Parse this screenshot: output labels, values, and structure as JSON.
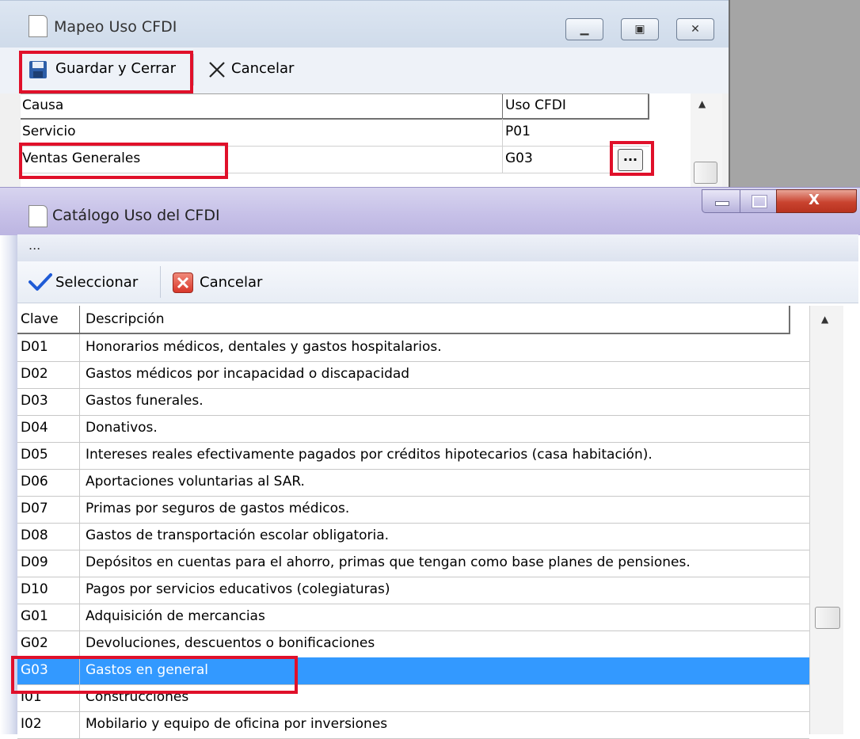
{
  "top_window": {
    "title": "Mapeo Uso CFDI",
    "toolbar": {
      "save_label": "Guardar y Cerrar",
      "cancel_label": "Cancelar"
    },
    "columns": [
      "Causa",
      "Uso CFDI"
    ],
    "rows": [
      {
        "causa": "Servicio",
        "uso": "P01"
      },
      {
        "causa": "Ventas Generales",
        "uso": "G03"
      }
    ],
    "ellipsis_label": "..."
  },
  "catalog_window": {
    "title": "Catálogo Uso del CFDI",
    "menu_dots": "...",
    "toolbar": {
      "select_label": "Seleccionar",
      "cancel_label": "Cancelar"
    },
    "columns": [
      "Clave",
      "Descripción"
    ],
    "rows": [
      {
        "clave": "D01",
        "descripcion": "Honorarios médicos, dentales y gastos hospitalarios."
      },
      {
        "clave": "D02",
        "descripcion": "Gastos médicos por incapacidad o discapacidad"
      },
      {
        "clave": "D03",
        "descripcion": "Gastos funerales."
      },
      {
        "clave": "D04",
        "descripcion": "Donativos."
      },
      {
        "clave": "D05",
        "descripcion": "Intereses reales efectivamente pagados por créditos hipotecarios (casa habitación)."
      },
      {
        "clave": "D06",
        "descripcion": "Aportaciones voluntarias al SAR."
      },
      {
        "clave": "D07",
        "descripcion": "Primas por seguros de gastos médicos."
      },
      {
        "clave": "D08",
        "descripcion": "Gastos de transportación escolar obligatoria."
      },
      {
        "clave": "D09",
        "descripcion": "Depósitos en cuentas para el ahorro, primas que tengan como base planes de pensiones."
      },
      {
        "clave": "D10",
        "descripcion": "Pagos por servicios educativos (colegiaturas)"
      },
      {
        "clave": "G01",
        "descripcion": "Adquisición de mercancias"
      },
      {
        "clave": "G02",
        "descripcion": "Devoluciones, descuentos o bonificaciones"
      },
      {
        "clave": "G03",
        "descripcion": "Gastos en general"
      },
      {
        "clave": "I01",
        "descripcion": "Construcciones"
      },
      {
        "clave": "I02",
        "descripcion": "Mobilario y equipo de oficina por inversiones"
      }
    ],
    "selected_clave": "G03"
  },
  "colors": {
    "highlight_red": "#e0102a",
    "selection_blue": "#3399ff",
    "close_red": "#c9432f"
  }
}
